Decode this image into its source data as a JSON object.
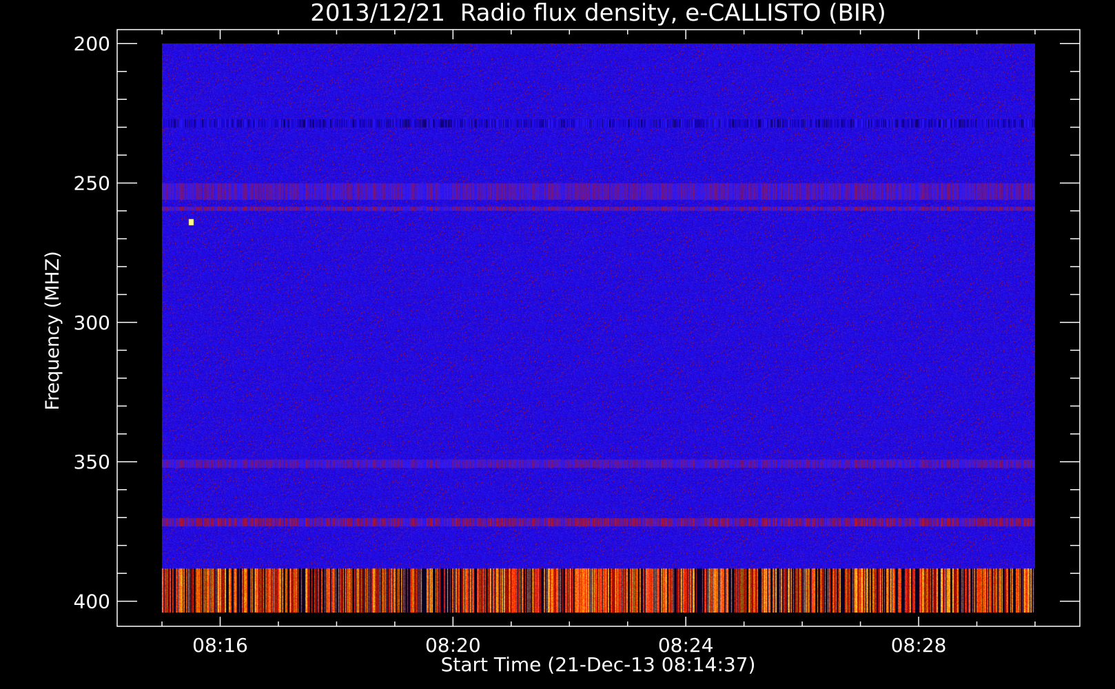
{
  "chart_data": {
    "type": "heatmap",
    "title": "2013/12/21  Radio flux density, e-CALLISTO (BIR)",
    "xlabel": "Start Time (21-Dec-13 08:14:37)",
    "ylabel": "Frequency (MHZ)",
    "x_tick_labels": [
      "08:16",
      "08:20",
      "08:24",
      "08:28"
    ],
    "x_major_ticks_minutes": [
      16,
      20,
      24,
      28
    ],
    "x_minor_tick_step_minutes": 1,
    "x_range_minutes": [
      14.23,
      30.77
    ],
    "data_time_range_minutes": [
      15.0,
      30.0
    ],
    "y_tick_labels": [
      "200",
      "250",
      "300",
      "350",
      "400"
    ],
    "y_major_ticks": [
      200,
      250,
      300,
      350,
      400
    ],
    "y_minor_tick_step": 10,
    "y_range": [
      195,
      409
    ],
    "y_reversed": true,
    "data_freq_range": [
      200,
      404
    ],
    "colormap": [
      "#000000",
      "#1a00c8",
      "#2a1aff",
      "#a01232",
      "#ff2000",
      "#ff9a00",
      "#ffff80"
    ],
    "background": "#000000",
    "axis_color": "#ffffff",
    "features": [
      {
        "kind": "band",
        "freq": [
          227,
          230
        ],
        "intensity": 0.05
      },
      {
        "kind": "band",
        "freq": [
          250,
          256
        ],
        "intensity": 0.35
      },
      {
        "kind": "band",
        "freq": [
          258.5,
          260
        ],
        "intensity": 0.45
      },
      {
        "kind": "band",
        "freq": [
          349,
          352
        ],
        "intensity": 0.35
      },
      {
        "kind": "band",
        "freq": [
          370,
          373
        ],
        "intensity": 0.55
      },
      {
        "kind": "band",
        "freq": [
          388,
          404
        ],
        "intensity": 0.75
      },
      {
        "kind": "point",
        "time": 15.5,
        "freq": 264,
        "intensity": 1.0
      }
    ]
  }
}
